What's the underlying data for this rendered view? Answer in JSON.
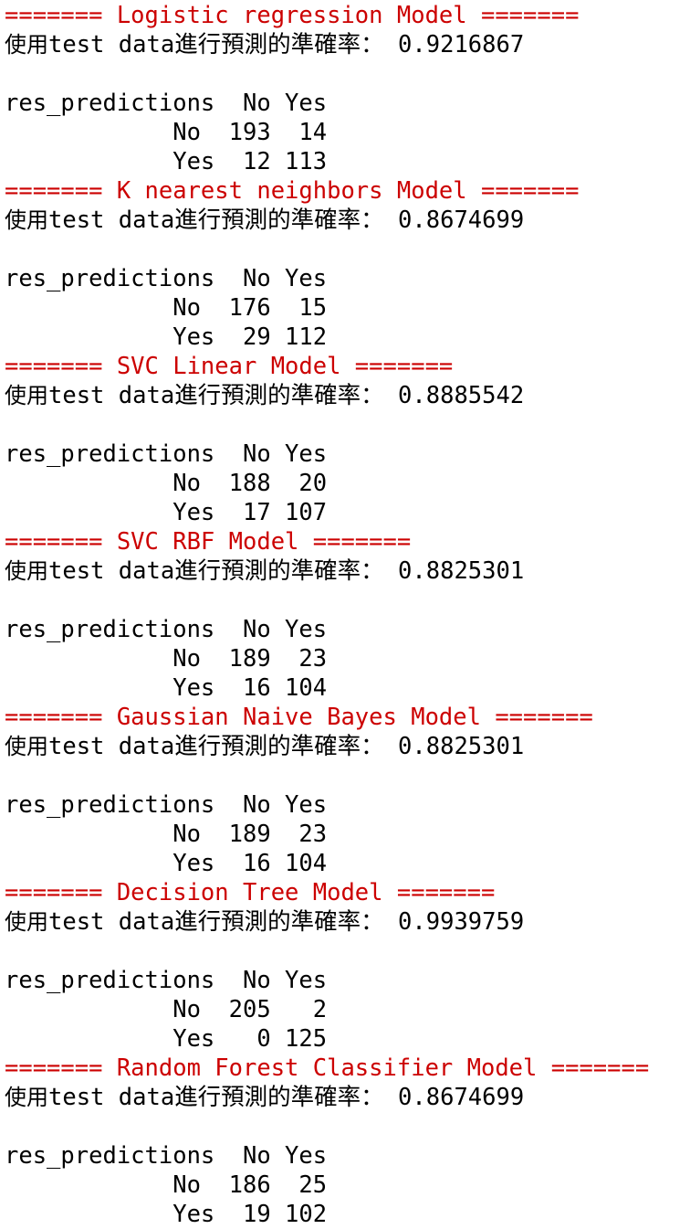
{
  "colors": {
    "header_text": "#cc0000",
    "output_text": "#000000",
    "background": "#ffffff"
  },
  "accuracy_prefix": "使用",
  "accuracy_label": "test data進行預測的準確率：",
  "table_header": "res_predictions  No Yes",
  "row_labels": [
    "No",
    "Yes"
  ],
  "models": [
    {
      "header": "======= Logistic regression Model =======",
      "accuracy": "0.9216867",
      "rows": [
        "            No  193  14",
        "            Yes  12 113"
      ]
    },
    {
      "header": "======= K nearest neighbors Model =======",
      "accuracy": "0.8674699",
      "rows": [
        "            No  176  15",
        "            Yes  29 112"
      ]
    },
    {
      "header": "======= SVC Linear Model =======",
      "accuracy": "0.8885542",
      "rows": [
        "            No  188  20",
        "            Yes  17 107"
      ]
    },
    {
      "header": "======= SVC RBF Model =======",
      "accuracy": "0.8825301",
      "rows": [
        "            No  189  23",
        "            Yes  16 104"
      ]
    },
    {
      "header": "======= Gaussian Naive Bayes Model =======",
      "accuracy": "0.8825301",
      "rows": [
        "            No  189  23",
        "            Yes  16 104"
      ]
    },
    {
      "header": "======= Decision Tree Model =======",
      "accuracy": "0.9939759",
      "rows": [
        "            No  205   2",
        "            Yes   0 125"
      ]
    },
    {
      "header": "======= Random Forest Classifier Model =======",
      "accuracy": "0.8674699",
      "rows": [
        "            No  186  25",
        "            Yes  19 102"
      ]
    }
  ]
}
